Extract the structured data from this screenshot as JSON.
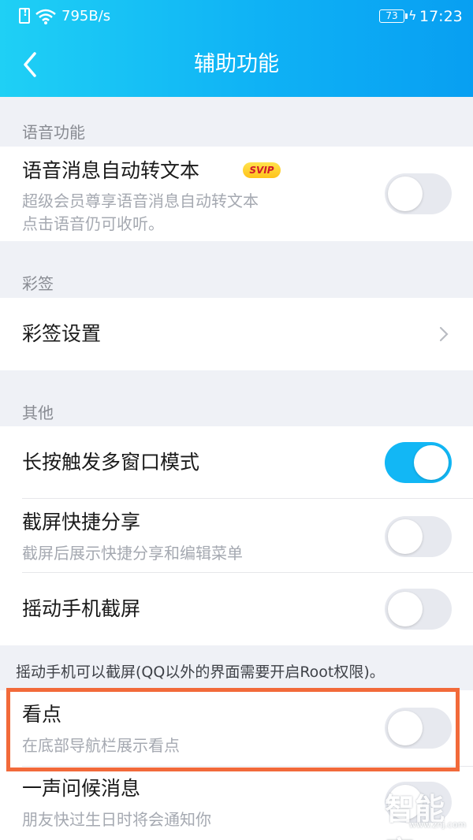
{
  "status": {
    "speed": "795B/s",
    "battery": "73",
    "time": "17:23"
  },
  "header": {
    "title": "辅助功能"
  },
  "sections": {
    "voice": {
      "label": "语音功能"
    },
    "caiqian": {
      "label": "彩签"
    },
    "other": {
      "label": "其他"
    }
  },
  "rows": {
    "voice_to_text": {
      "title": "语音消息自动转文本",
      "badge": "SVIP",
      "sub1": "超级会员尊享语音消息自动转文本",
      "sub2": "点击语音仍可收听。",
      "on": false
    },
    "caiqian_settings": {
      "title": "彩签设置"
    },
    "long_press_multiwindow": {
      "title": "长按触发多窗口模式",
      "on": true
    },
    "screenshot_share": {
      "title": "截屏快捷分享",
      "sub": "截屏后展示快捷分享和编辑菜单",
      "on": false
    },
    "shake_screenshot": {
      "title": "摇动手机截屏",
      "on": false
    },
    "kandian": {
      "title": "看点",
      "sub": "在底部导航栏展示看点",
      "on": false
    },
    "greeting": {
      "title": "一声问候消息",
      "sub": "朋友快过生日时将会通知你",
      "on": false
    }
  },
  "note": "摇动手机可以截屏(QQ以外的界面需要开启Root权限)。",
  "watermark": {
    "text": "智能家",
    "url": "www.znj.com"
  },
  "colors": {
    "accent": "#12b7f5",
    "highlight": "#f26a3a"
  }
}
